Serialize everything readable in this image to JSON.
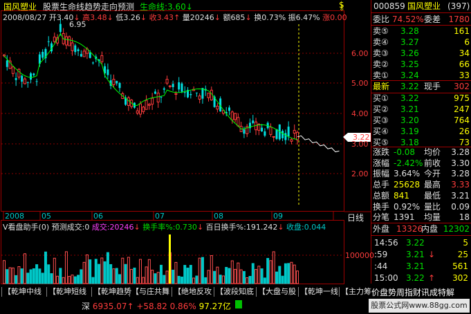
{
  "header": {
    "stock_name": "国风塑业",
    "indicator_title": "股票生命线趋势走向预测",
    "lifeline_label": "生命线:",
    "lifeline_value": "3.60",
    "lifeline_arrow": "↓",
    "icon_top": "dollar-icon"
  },
  "info_bar": {
    "date": "2008/08/27",
    "open_label": "开",
    "open": "3.40",
    "open_arrow": "↓",
    "high_label": "高",
    "high": "3.48",
    "high_arrow": "↓",
    "low_label": "低",
    "low": "3.26",
    "low_arrow": "↓",
    "close_label": "收",
    "close": "3.43",
    "close_arrow": "↑",
    "vol_label": "量",
    "vol": "20246",
    "vol_arrow": "↓",
    "amt_label": "额",
    "amt": "685",
    "amt_arrow": "↓",
    "turnover_label": "换",
    "turnover": "0.73%",
    "amp_label": "振",
    "amp": "6.47%",
    "chg_label": "涨",
    "chg": "0.00"
  },
  "price_axis": [
    "6.00",
    "5.00",
    "4.00",
    "3.00",
    "2.00"
  ],
  "current_price_tag": "3.22",
  "peak_label": "6.95",
  "time_axis": [
    "2008",
    "05",
    "06",
    "07",
    "08",
    "09"
  ],
  "period_button": "日线",
  "sub_chart": {
    "indicator": "V看盘助手(0)",
    "forecast_label": "预测成交:",
    "forecast_value": "0",
    "volume_label": "成交:",
    "volume_value": "20246",
    "volume_arrow": "↓",
    "turnover_rate_label": "换手率%:",
    "turnover_rate_value": "0.730",
    "turnover_rate_arrow": "↓",
    "hundred_day_label": "百日换手%:",
    "hundred_day_value": "191.242",
    "hundred_day_arrow": "↓",
    "close_vol_label": "收盘:",
    "close_vol_value": "0.044",
    "axis_value": "100000"
  },
  "tabs": [
    "乾坤中线",
    "乾坤短线",
    "乾坤趋势",
    "与庄共舞",
    "绝地反攻",
    "波段知底",
    "大盘与股",
    "乾坤一线",
    "主力筹码"
  ],
  "scroll_text": "价盘势周指财讯成特解",
  "status_bar": {
    "market": "深",
    "index": "6935.07",
    "index_arrow": "↑",
    "change": "+58.82",
    "pct": "0.86%",
    "ratio": "97.27亿",
    "watermark": "股票公式网www.88gg.com"
  },
  "quote_panel": {
    "code": "000859",
    "name": "国风塑业",
    "num": "(397)",
    "weibi_label": "委比",
    "weibi": "74.52%",
    "weicha_label": "委差",
    "weicha": "1780",
    "sells": [
      {
        "label": "卖⑤",
        "price": "3.28",
        "vol": "161"
      },
      {
        "label": "卖④",
        "price": "3.27",
        "vol": "6"
      },
      {
        "label": "卖③",
        "price": "3.26",
        "vol": "34"
      },
      {
        "label": "卖②",
        "price": "3.25",
        "vol": "66"
      },
      {
        "label": "卖①",
        "price": "3.24",
        "vol": "33"
      }
    ],
    "latest_label": "最新",
    "latest": "3.22",
    "hand_label": "现手",
    "hand": "302",
    "buys": [
      {
        "label": "买①",
        "price": "3.22",
        "vol": "975"
      },
      {
        "label": "买②",
        "price": "3.21",
        "vol": "247"
      },
      {
        "label": "买③",
        "price": "3.20",
        "vol": "764"
      },
      {
        "label": "买④",
        "price": "3.19",
        "vol": "26"
      },
      {
        "label": "买⑤",
        "price": "3.18",
        "vol": "73"
      }
    ],
    "stats": [
      {
        "l1": "涨跌",
        "v1": "-0.08",
        "l2": "均价",
        "v2": "3.28"
      },
      {
        "l1": "涨幅",
        "v1": "-2.42%",
        "l2": "前收",
        "v2": "3.30"
      },
      {
        "l1": "振幅",
        "v1": "3.64%",
        "l2": "今开",
        "v2": "3.28"
      },
      {
        "l1": "总手",
        "v1": "25628",
        "l2": "最高",
        "v2": "3.33"
      },
      {
        "l1": "总额",
        "v1": "841",
        "l2": "最低",
        "v2": "3.21"
      },
      {
        "l1": "换手",
        "v1": "0.92%",
        "l2": "量比",
        "v2": "0.09"
      },
      {
        "l1": "分笔",
        "v1": "1391",
        "l2": "均量",
        "v2": "18"
      }
    ],
    "outer_label": "外盘",
    "outer": "13326",
    "inner_label": "内盘",
    "inner": "12302",
    "ticks": [
      {
        "time": "14:56",
        "price": "3.22",
        "arrow": "",
        "vol": "5"
      },
      {
        "time": ":59",
        "price": "3.21",
        "arrow": "↓",
        "vol": "25"
      },
      {
        "time": ":44",
        "price": "3.21",
        "arrow": "",
        "vol": "561"
      },
      {
        "time": "15:00",
        "price": "3.22",
        "arrow": "↑",
        "vol": "302"
      }
    ]
  },
  "colors": {
    "up": "#ff3c3c",
    "down": "#00e0e0",
    "line": "#00ff00",
    "grid": "#a00000",
    "volume": "#ff6060",
    "highlight": "#ffff00"
  }
}
